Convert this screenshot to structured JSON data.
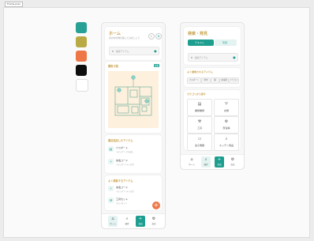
{
  "frame_label": "Frame prev",
  "palette": [
    "#27A195",
    "#BAAA45",
    "#EE7747",
    "#0D0D0D",
    "#FFFFFF"
  ],
  "home": {
    "title": "ホーム",
    "subtitle": "家の中の物を探してみましょう",
    "search_placeholder": "検索アイテム",
    "map": {
      "title": "間取り図",
      "edit": "編集"
    },
    "recent": {
      "title": "最近追加したアイテム",
      "items": [
        {
          "name": "パスポート",
          "location": "リビング > 引き出し"
        },
        {
          "name": "充電コード",
          "location": "リビング > テレビ台"
        }
      ]
    },
    "frequent": {
      "title": "よく検索するアイテム",
      "items": [
        {
          "name": "充電コード",
          "location": "リビング > テレビ台"
        },
        {
          "name": "工具セット",
          "location": "クローゼット"
        }
      ]
    },
    "fab": "+"
  },
  "search_screen": {
    "title": "検索・発見",
    "tabs": [
      "テキスト",
      "写真"
    ],
    "search_placeholder": "検索アイテム",
    "popular_title": "よく検索されるアイテム",
    "popular_tags": [
      "パスポート",
      "財布",
      "鍵",
      "充電器",
      "リモコン"
    ],
    "category_title": "カテゴリから探す",
    "categories": [
      {
        "label": "書類書類",
        "icon": "document-icon",
        "glyph": "▤"
      },
      {
        "label": "衣類",
        "icon": "shirt-icon",
        "glyph": "♈"
      },
      {
        "label": "工具",
        "icon": "tool-icon",
        "glyph": "⚒"
      },
      {
        "label": "家電等",
        "icon": "gear-icon",
        "glyph": "⚙"
      },
      {
        "label": "電子機器",
        "icon": "device-icon",
        "glyph": "▭"
      },
      {
        "label": "キッチン用品",
        "icon": "kitchen-icon",
        "glyph": "⌕"
      }
    ]
  },
  "nav": [
    {
      "label": "ホーム",
      "icon": "home-icon",
      "glyph": "⌂"
    },
    {
      "label": "検索",
      "icon": "search-icon",
      "glyph": "⌕"
    },
    {
      "label": "追加",
      "icon": "plus-icon",
      "glyph": "+"
    },
    {
      "label": "設定",
      "icon": "settings-icon",
      "glyph": "⚙"
    }
  ]
}
